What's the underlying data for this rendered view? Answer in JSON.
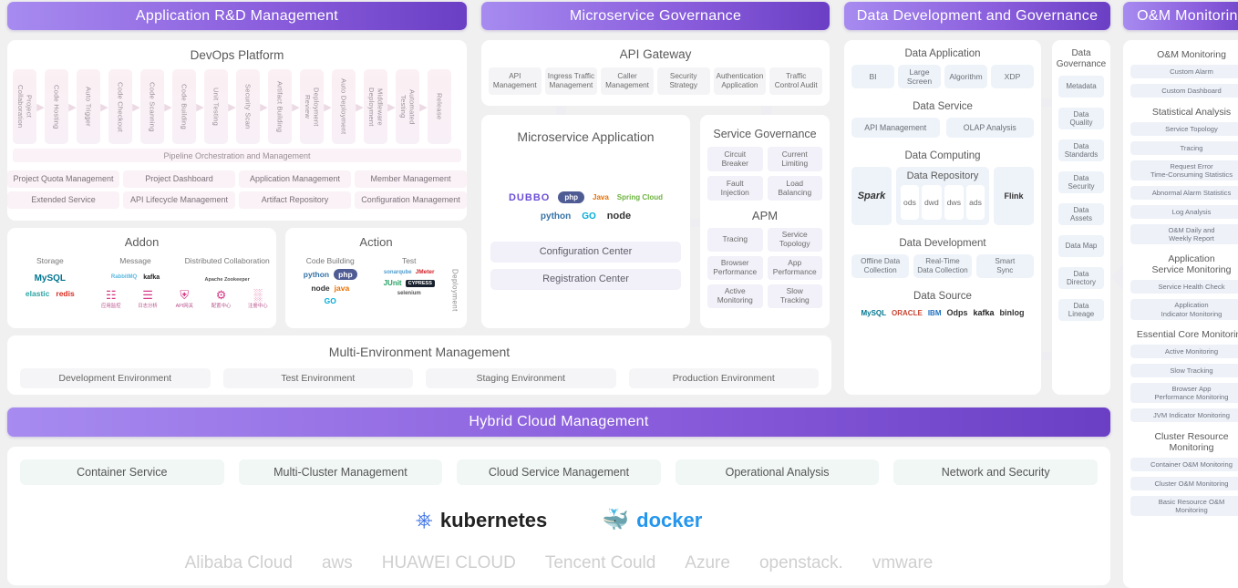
{
  "headers": {
    "app_rd": "Application R&D Management",
    "microservice": "Microservice Governance",
    "data_dev": "Data Development and Governance",
    "om": "O&M Monitoring",
    "hybrid": "Hybrid Cloud Management"
  },
  "devops": {
    "title": "DevOps Platform",
    "pipeline": [
      "Project\nCollaboration",
      "Code Hosting",
      "Auto Trigger",
      "Code Checkout",
      "Code Scanning",
      "Code Building",
      "Unit Testing",
      "Security Scan",
      "Artifact Building",
      "Deployment\nReview",
      "Auto Deployment",
      "Middleware\nDeployment",
      "Automated\nTesting",
      "Release"
    ],
    "orchestration": "Pipeline Orchestration and Management",
    "features": [
      "Project Quota Management",
      "Project Dashboard",
      "Application Management",
      "Member Management",
      "Extended Service",
      "API Lifecycle Management",
      "Artifact Repository",
      "Configuration Management"
    ]
  },
  "addon": {
    "title": "Addon",
    "groups": [
      "Storage",
      "Message",
      "Distributed Collaboration"
    ],
    "storage_logos": [
      "MySQL",
      "elastic",
      "redis"
    ],
    "message_logos": [
      "RabbitMQ",
      "kafka"
    ],
    "distributed_logos": [
      "Apache Zookeeper"
    ],
    "icons": [
      {
        "glyph": "☷",
        "label": "应用监控"
      },
      {
        "glyph": "☰",
        "label": "日志分析"
      },
      {
        "glyph": "⛨",
        "label": "API网关"
      },
      {
        "glyph": "⚙",
        "label": "配置中心"
      },
      {
        "glyph": "░",
        "label": "注册中心"
      }
    ]
  },
  "action": {
    "title": "Action",
    "groups": [
      "Code Building",
      "Test"
    ],
    "build_logos": [
      "python",
      "php",
      "node",
      "java",
      "GO"
    ],
    "test_logos": [
      "sonarqube",
      "JMeter",
      "JUnit",
      "CYPRESS",
      "selenium"
    ],
    "vertical": "Deployment"
  },
  "multi_env": {
    "title": "Multi-Environment Management",
    "items": [
      "Development Environment",
      "Test Environment",
      "Staging Environment",
      "Production Environment"
    ]
  },
  "api_gateway": {
    "title": "API Gateway",
    "items": [
      "API\nManagement",
      "Ingress Traffic\nManagement",
      "Caller\nManagement",
      "Security\nStrategy",
      "Authentication\nApplication",
      "Traffic\nControl Audit"
    ]
  },
  "microservice_app": {
    "title": "Microservice Application",
    "logos_row1": [
      "DUBBO",
      "php",
      "Java",
      "Spring Cloud"
    ],
    "logos_row2": [
      "python",
      "GO",
      "node"
    ],
    "centers": [
      "Configuration Center",
      "Registration Center"
    ]
  },
  "service_governance": {
    "title": "Service Governance",
    "items": [
      "Circuit\nBreaker",
      "Current\nLimiting",
      "Fault\nInjection",
      "Load\nBalancing"
    ]
  },
  "apm": {
    "title": "APM",
    "items": [
      "Tracing",
      "Service\nTopology",
      "Browser\nPerformance",
      "App\nPerformance",
      "Active\nMonitoring",
      "Slow\nTracking"
    ]
  },
  "data_application": {
    "title": "Data Application",
    "items": [
      "BI",
      "Large\nScreen",
      "Algorithm",
      "XDP"
    ]
  },
  "data_service": {
    "title": "Data Service",
    "items": [
      "API Management",
      "OLAP Analysis"
    ]
  },
  "data_computing": {
    "title": "Data Computing",
    "left_engine": "Spark",
    "right_engine": "Flink",
    "repository_title": "Data Repository",
    "layers": [
      "ods",
      "dwd",
      "dws",
      "ads"
    ]
  },
  "data_development": {
    "title": "Data Development",
    "items": [
      "Offline Data\nCollection",
      "Real-Time\nData Collection",
      "Smart\nSync"
    ]
  },
  "data_source": {
    "title": "Data Source",
    "logos": [
      "MySQL",
      "ORACLE",
      "IBM",
      "Odps",
      "kafka",
      "binlog"
    ]
  },
  "data_governance": {
    "title": "Data\nGovernance",
    "items": [
      "Metadata",
      "Data\nQuality",
      "Data\nStandards",
      "Data\nSecurity",
      "Data\nAssets",
      "Data Map",
      "Data\nDirectory",
      "Data\nLineage"
    ]
  },
  "om_monitoring": {
    "sections": [
      {
        "label": "O&M Monitoring",
        "items": [
          "Custom Alarm",
          "Custom Dashboard"
        ]
      },
      {
        "label": "Statistical Analysis",
        "items": [
          "Service Topology",
          "Tracing",
          "Request Error\nTime-Consuming Statistics",
          "Abnormal Alarm Statistics",
          "Log Analysis",
          "O&M Daily and\nWeekly Report"
        ]
      },
      {
        "label": "Application\nService Monitoring",
        "items": [
          "Service Health Check",
          "Application\nIndicator Monitoring"
        ]
      },
      {
        "label": "Essential Core Monitoring",
        "items": [
          "Active Monitoring",
          "Slow Tracking",
          "Browser App\nPerformance Monitoring",
          "JVM Indicator Monitoring"
        ]
      },
      {
        "label": "Cluster Resource\nMonitoring",
        "items": [
          "Container O&M Monitoring",
          "Cluster O&M Monitoring",
          "Basic Resource O&M\nMonitoring"
        ]
      }
    ]
  },
  "hybrid_cloud": {
    "items": [
      "Container Service",
      "Multi-Cluster Management",
      "Cloud Service Management",
      "Operational Analysis",
      "Network and Security"
    ],
    "platforms": [
      "kubernetes",
      "docker"
    ],
    "vendors": [
      "Alibaba Cloud",
      "aws",
      "HUAWEI CLOUD",
      "Tencent Could",
      "Azure",
      "openstack.",
      "vmware"
    ]
  },
  "colors": {
    "header_start": "#a78bf0",
    "header_end": "#6b3fc4",
    "pill_grey": "#f4f4f6",
    "pill_blue": "#eef3f9",
    "pill_green": "#eff7f4",
    "accent_pink": "#d63a86"
  }
}
